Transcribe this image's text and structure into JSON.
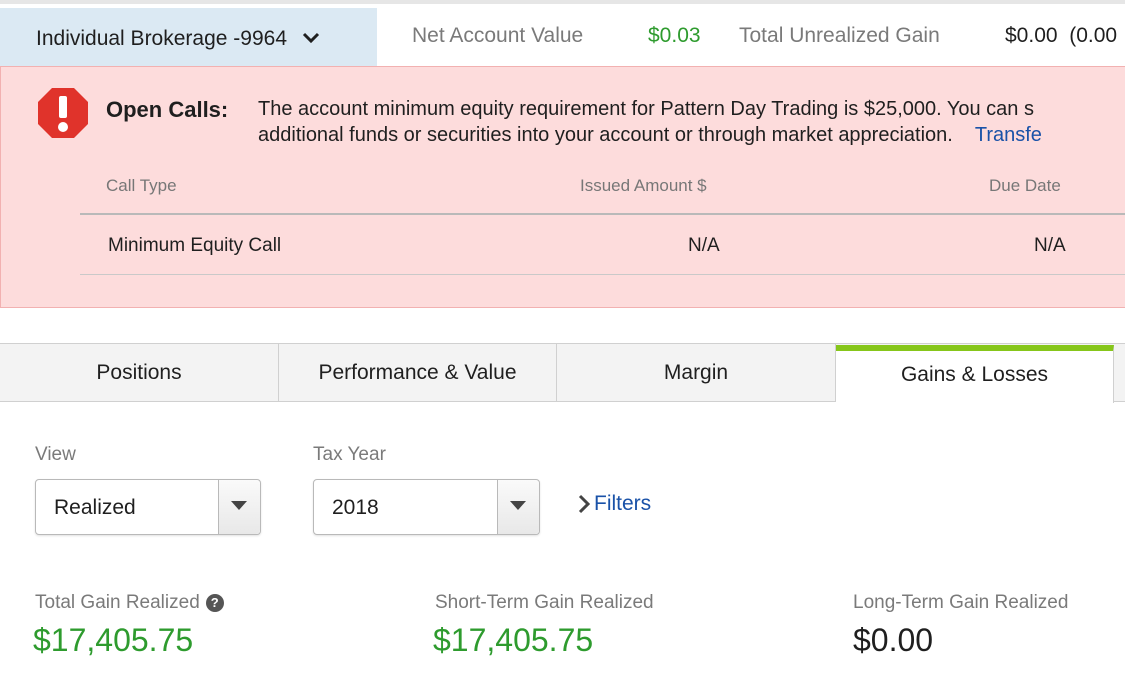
{
  "header": {
    "account_name": "Individual Brokerage -9964",
    "net_value_label": "Net Account Value",
    "net_value": "$0.03",
    "unrealized_label": "Total Unrealized Gain",
    "unrealized_value": "$0.00  (0.00"
  },
  "alert": {
    "icon": "exclamation-octagon-icon",
    "title": "Open Calls:",
    "message_line1": "The account minimum equity requirement for Pattern Day Trading is $25,000. You can s",
    "message_line2": "additional funds or securities into your account or through market appreciation.",
    "link": "Transfe",
    "table": {
      "headers": [
        "Call Type",
        "Issued Amount $",
        "Due Date"
      ],
      "rows": [
        [
          "Minimum Equity Call",
          "N/A",
          "N/A"
        ]
      ]
    }
  },
  "tabs": [
    {
      "label": "Positions",
      "active": false
    },
    {
      "label": "Performance & Value",
      "active": false
    },
    {
      "label": "Margin",
      "active": false
    },
    {
      "label": "Gains & Losses",
      "active": true
    }
  ],
  "filters": {
    "view_label": "View",
    "view_value": "Realized",
    "tax_year_label": "Tax Year",
    "tax_year_value": "2018",
    "filters_link": "Filters"
  },
  "totals": {
    "total_label": "Total Gain Realized",
    "total_value": "$17,405.75",
    "short_label": "Short-Term Gain Realized",
    "short_value": "$17,405.75",
    "long_label": "Long-Term Gain Realized",
    "long_value": "$0.00"
  },
  "colors": {
    "gain_green": "#2e9b2e",
    "alert_red": "#e0332b",
    "active_tab_accent": "#86c61a",
    "link_blue": "#1a52a8"
  }
}
